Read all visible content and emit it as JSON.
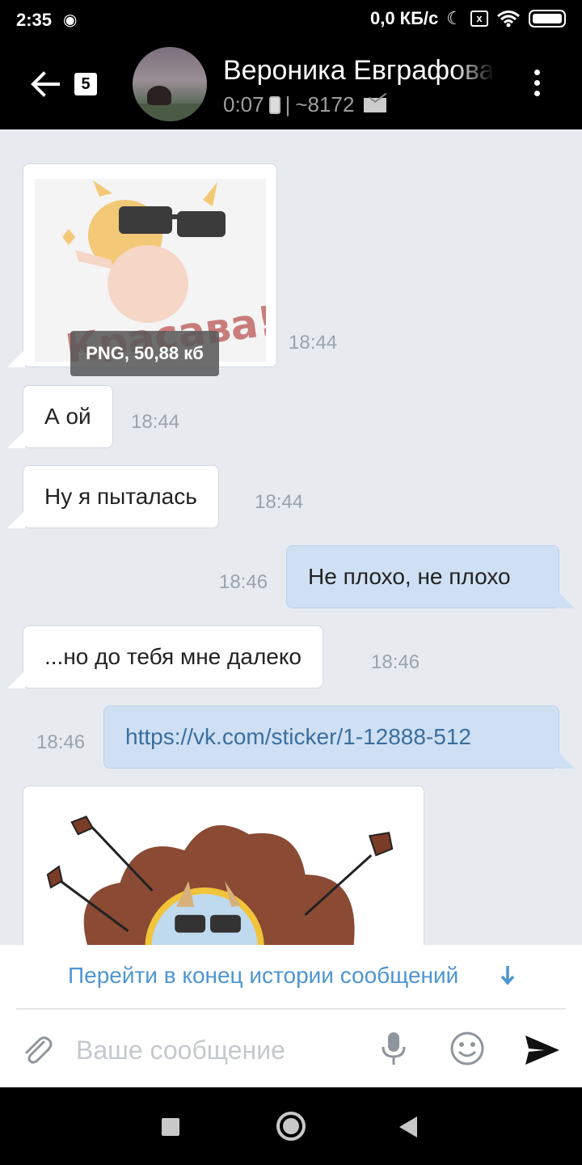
{
  "status_bar": {
    "time": "2:35",
    "network_speed": "0,0 КБ/с",
    "sim_icon_label": "x",
    "icons": [
      "notification-icon",
      "moon-icon",
      "sim-icon",
      "wifi-icon",
      "battery-icon"
    ]
  },
  "header": {
    "unread_count": "5",
    "contact_name": "Вероника Евграфова",
    "last_seen": "0:07",
    "separator": "|",
    "message_count": "~8172",
    "icons": [
      "back-arrow-icon",
      "phone-icon",
      "mail-icon",
      "more-vertical-icon"
    ]
  },
  "messages": [
    {
      "direction": "in",
      "type": "sticker-file",
      "file_label": "PNG, 50,88 кб",
      "sticker_text": "Красава!",
      "time": "18:44"
    },
    {
      "direction": "in",
      "type": "text",
      "text": "А ой",
      "time": "18:44"
    },
    {
      "direction": "in",
      "type": "text",
      "text": "Ну я пыталась",
      "time": "18:44"
    },
    {
      "direction": "out",
      "type": "text",
      "text": "Не плохо, не плохо",
      "time": "18:46"
    },
    {
      "direction": "in",
      "type": "text",
      "text": "...но до тебя мне далеко",
      "time": "18:46"
    },
    {
      "direction": "out",
      "type": "link",
      "text": "https://vk.com/sticker/1-12888-512",
      "time": "18:46"
    },
    {
      "direction": "in",
      "type": "sticker",
      "time": ""
    }
  ],
  "footer": {
    "jump_label": "Перейти в конец истории сообщений",
    "input_placeholder": "Ваше сообщение",
    "icons": [
      "attach-icon",
      "microphone-icon",
      "emoji-icon",
      "send-icon"
    ]
  },
  "colors": {
    "background": "#e7ebf0",
    "incoming_bubble": "#ffffff",
    "outgoing_bubble": "#cfe0f4",
    "link": "#3b6e9e",
    "accent": "#4e95d1",
    "timestamp": "#9aa3ad"
  }
}
